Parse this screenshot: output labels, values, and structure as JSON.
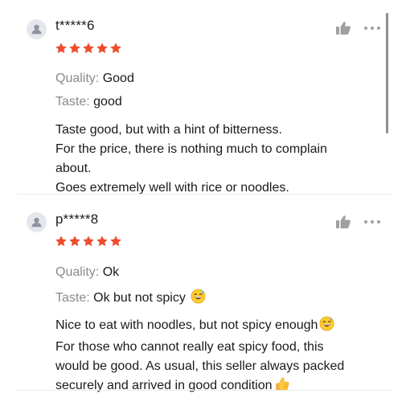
{
  "reviews": [
    {
      "username": "t*****6",
      "rating": 5,
      "quality_label": "Quality:",
      "quality_value": "Good",
      "taste_label": "Taste:",
      "taste_value": "good",
      "text_lines": [
        "Taste good, but with a hint of bitterness.",
        "For the price, there is nothing much to complain",
        "about.",
        "Goes extremely well with rice or noodles."
      ]
    },
    {
      "username": "p*****8",
      "rating": 5,
      "quality_label": "Quality:",
      "quality_value": "Ok",
      "taste_label": "Taste:",
      "taste_value": "Ok but not spicy",
      "text_lines": [
        "Nice to eat with noodles, but not spicy enough",
        "For those who cannot really eat spicy food, this",
        "would be good. As usual, this seller always packed",
        "securely and arrived in good condition"
      ]
    }
  ],
  "icons": {
    "avatar": "person-icon",
    "star": "star-icon",
    "like": "thumbs-up-icon",
    "more": "more-dots-icon",
    "emoji_sweat": "grinning-sweat-emoji-icon",
    "emoji_thumbs": "thumbs-up-emoji-icon"
  },
  "colors": {
    "star": "#ee4d2d",
    "label": "#8a8a8a",
    "text": "#1a1a1a",
    "icon_gray": "#a0a0a0",
    "avatar_bg": "#e6e7ec"
  }
}
